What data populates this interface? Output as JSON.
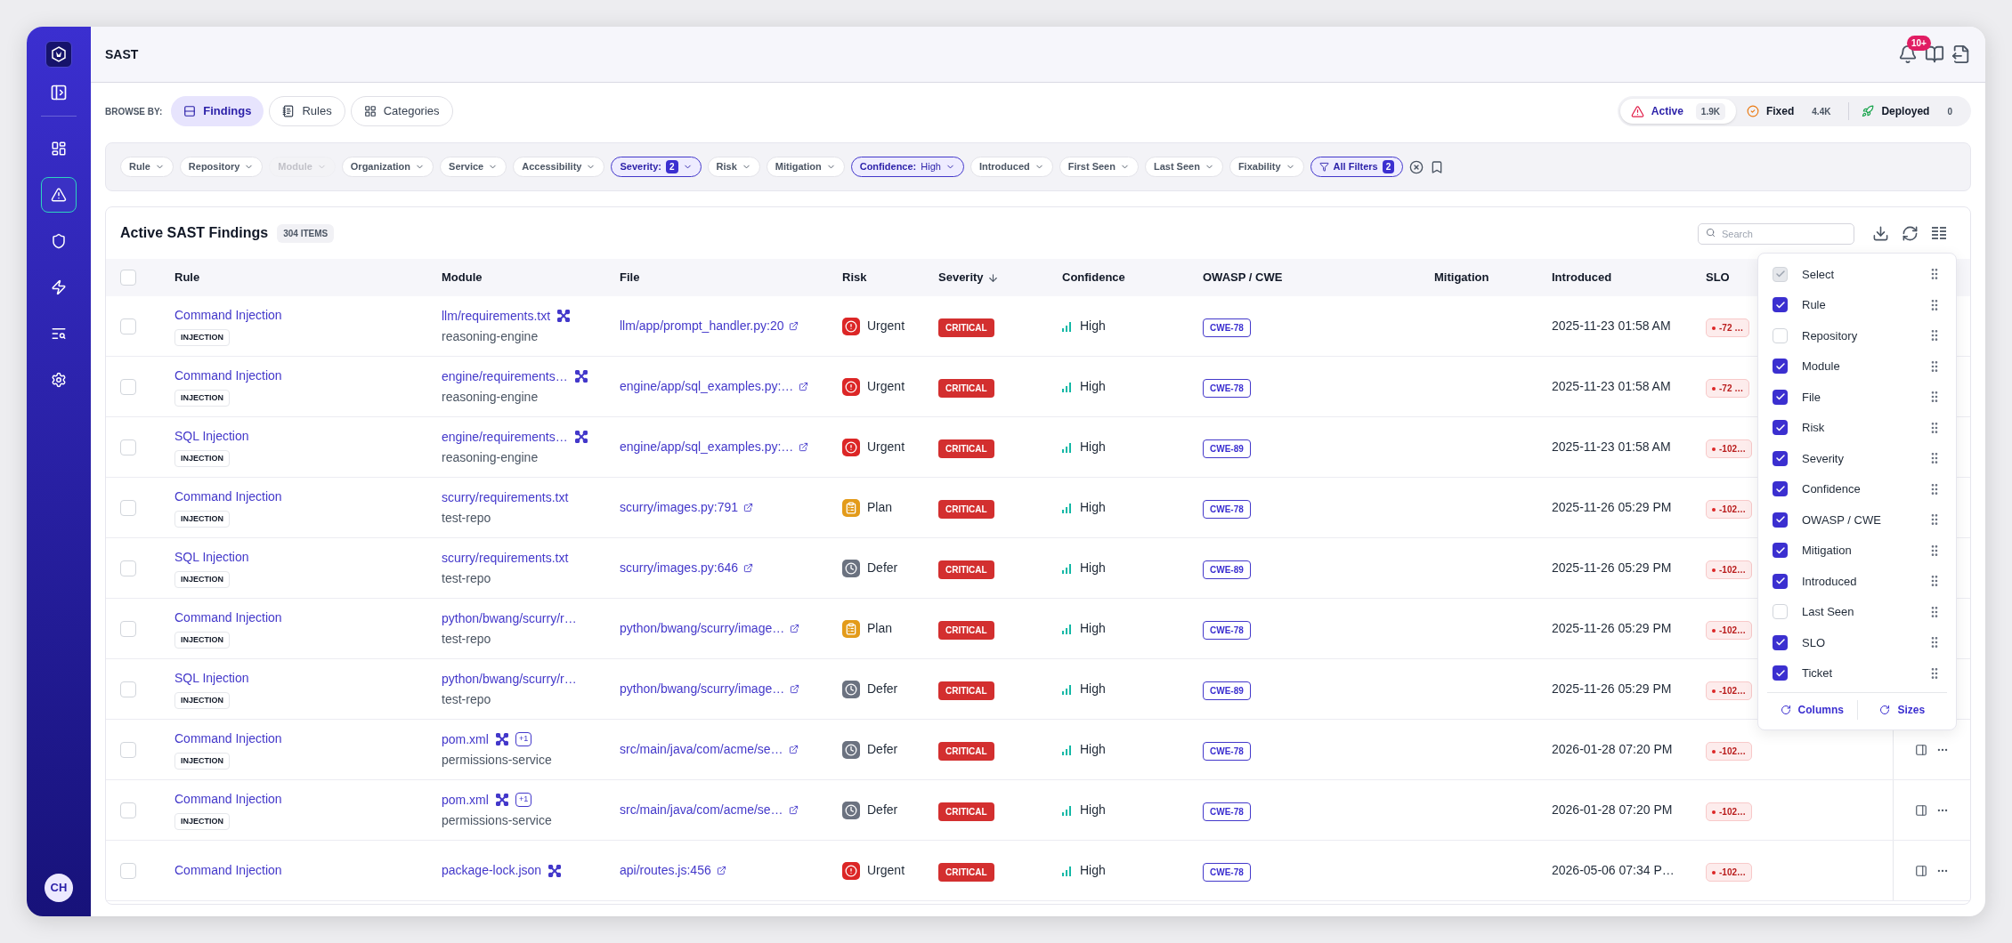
{
  "sidebar": {
    "items": [
      {
        "kind": "dashboard",
        "selected": false
      },
      {
        "kind": "alert",
        "selected": true
      },
      {
        "kind": "shield",
        "selected": false
      },
      {
        "kind": "zap",
        "selected": false
      },
      {
        "kind": "search-list",
        "selected": false
      },
      {
        "kind": "settings",
        "selected": false
      }
    ],
    "avatar": "CH"
  },
  "header": {
    "title": "SAST",
    "notifications": "10+"
  },
  "browse": {
    "label": "BROWSE BY:",
    "options": [
      {
        "label": "Findings",
        "kind": "findings",
        "selected": true
      },
      {
        "label": "Rules",
        "kind": "rules",
        "selected": false
      },
      {
        "label": "Categories",
        "kind": "categories",
        "selected": false
      }
    ]
  },
  "status": {
    "items": [
      {
        "label": "Active",
        "count": "1.9K",
        "kind": "active",
        "selected": true
      },
      {
        "label": "Fixed",
        "count": "4.4K",
        "kind": "fixed",
        "selected": false
      },
      {
        "label": "Deployed",
        "count": "0",
        "kind": "deployed",
        "selected": false
      }
    ]
  },
  "filters": [
    {
      "label": "Rule",
      "active": false,
      "disabled": false
    },
    {
      "label": "Repository",
      "active": false,
      "disabled": false
    },
    {
      "label": "Module",
      "active": false,
      "disabled": true
    },
    {
      "label": "Organization",
      "active": false,
      "disabled": false
    },
    {
      "label": "Service",
      "active": false,
      "disabled": false
    },
    {
      "label": "Accessibility",
      "active": false,
      "disabled": false
    },
    {
      "label": "Severity:",
      "count": "2",
      "active": true,
      "disabled": false
    },
    {
      "label": "Risk",
      "active": false,
      "disabled": false
    },
    {
      "label": "Mitigation",
      "active": false,
      "disabled": false
    },
    {
      "label": "Confidence:",
      "value": "High",
      "active": true,
      "disabled": false
    },
    {
      "label": "Introduced",
      "active": false,
      "disabled": false
    },
    {
      "label": "First Seen",
      "active": false,
      "disabled": false
    },
    {
      "label": "Last Seen",
      "active": false,
      "disabled": false
    },
    {
      "label": "Fixability",
      "active": false,
      "disabled": false
    }
  ],
  "all_filters": {
    "label": "All Filters",
    "count": "2"
  },
  "table": {
    "title": "Active SAST Findings",
    "count": "304 ITEMS",
    "search_placeholder": "Search",
    "select_all": false,
    "columns": [
      {
        "label": "Rule",
        "sorted": false
      },
      {
        "label": "Module",
        "sorted": false
      },
      {
        "label": "File",
        "sorted": false
      },
      {
        "label": "Risk",
        "sorted": false
      },
      {
        "label": "Severity",
        "sorted": true
      },
      {
        "label": "Confidence",
        "sorted": false
      },
      {
        "label": "OWASP / CWE",
        "sorted": false
      },
      {
        "label": "Mitigation",
        "sorted": false
      },
      {
        "label": "Introduced",
        "sorted": false
      },
      {
        "label": "SLO",
        "sorted": false
      }
    ],
    "rows": [
      {
        "selected": false,
        "rule": "Command Injection",
        "tag": "INJECTION",
        "module": "llm/requirements.txt",
        "linked": true,
        "repo": "reasoning-engine",
        "file": "llm/app/prompt_handler.py:20",
        "risk": {
          "label": "Urgent",
          "kind": "urgent"
        },
        "severity": "CRITICAL",
        "confidence": "High",
        "cwe": "CWE-78",
        "introduced": "2025-11-23 01:58 AM",
        "slo": "-72 …"
      },
      {
        "selected": false,
        "rule": "Command Injection",
        "tag": "INJECTION",
        "module": "engine/requirements…",
        "linked": true,
        "repo": "reasoning-engine",
        "file": "engine/app/sql_examples.py:…",
        "risk": {
          "label": "Urgent",
          "kind": "urgent"
        },
        "severity": "CRITICAL",
        "confidence": "High",
        "cwe": "CWE-78",
        "introduced": "2025-11-23 01:58 AM",
        "slo": "-72 …"
      },
      {
        "selected": false,
        "rule": "SQL Injection",
        "tag": "INJECTION",
        "module": "engine/requirements…",
        "linked": true,
        "repo": "reasoning-engine",
        "file": "engine/app/sql_examples.py:…",
        "risk": {
          "label": "Urgent",
          "kind": "urgent"
        },
        "severity": "CRITICAL",
        "confidence": "High",
        "cwe": "CWE-89",
        "introduced": "2025-11-23 01:58 AM",
        "slo": "-102…"
      },
      {
        "selected": false,
        "rule": "Command Injection",
        "tag": "INJECTION",
        "module": "scurry/requirements.txt",
        "linked": false,
        "repo": "test-repo",
        "file": "scurry/images.py:791",
        "risk": {
          "label": "Plan",
          "kind": "plan"
        },
        "severity": "CRITICAL",
        "confidence": "High",
        "cwe": "CWE-78",
        "introduced": "2025-11-26 05:29 PM",
        "slo": "-102…"
      },
      {
        "selected": false,
        "rule": "SQL Injection",
        "tag": "INJECTION",
        "module": "scurry/requirements.txt",
        "linked": false,
        "repo": "test-repo",
        "file": "scurry/images.py:646",
        "risk": {
          "label": "Defer",
          "kind": "defer"
        },
        "severity": "CRITICAL",
        "confidence": "High",
        "cwe": "CWE-89",
        "introduced": "2025-11-26 05:29 PM",
        "slo": "-102…"
      },
      {
        "selected": false,
        "rule": "Command Injection",
        "tag": "INJECTION",
        "module": "python/bwang/scurry/r…",
        "linked": false,
        "repo": "test-repo",
        "file": "python/bwang/scurry/image…",
        "risk": {
          "label": "Plan",
          "kind": "plan"
        },
        "severity": "CRITICAL",
        "confidence": "High",
        "cwe": "CWE-78",
        "introduced": "2025-11-26 05:29 PM",
        "slo": "-102…"
      },
      {
        "selected": false,
        "rule": "SQL Injection",
        "tag": "INJECTION",
        "module": "python/bwang/scurry/r…",
        "linked": false,
        "repo": "test-repo",
        "file": "python/bwang/scurry/image…",
        "risk": {
          "label": "Defer",
          "kind": "defer"
        },
        "severity": "CRITICAL",
        "confidence": "High",
        "cwe": "CWE-89",
        "introduced": "2025-11-26 05:29 PM",
        "slo": "-102…"
      },
      {
        "selected": false,
        "rule": "Command Injection",
        "tag": "INJECTION",
        "module": "pom.xml",
        "linked": true,
        "extra": "+1",
        "repo": "permissions-service",
        "file": "src/main/java/com/acme/se…",
        "risk": {
          "label": "Defer",
          "kind": "defer"
        },
        "severity": "CRITICAL",
        "confidence": "High",
        "cwe": "CWE-78",
        "introduced": "2026-01-28 07:20 PM",
        "slo": "-102…"
      },
      {
        "selected": false,
        "rule": "Command Injection",
        "tag": "INJECTION",
        "module": "pom.xml",
        "linked": true,
        "extra": "+1",
        "repo": "permissions-service",
        "file": "src/main/java/com/acme/se…",
        "risk": {
          "label": "Defer",
          "kind": "defer"
        },
        "severity": "CRITICAL",
        "confidence": "High",
        "cwe": "CWE-78",
        "introduced": "2026-01-28 07:20 PM",
        "slo": "-102…"
      },
      {
        "selected": false,
        "rule": "Command Injection",
        "module": "package-lock.json",
        "linked": true,
        "file": "api/routes.js:456",
        "risk": {
          "label": "Urgent",
          "kind": "urgent"
        },
        "severity": "CRITICAL",
        "confidence": "High",
        "cwe": "CWE-78",
        "introduced": "2026-05-06 07:34 P…",
        "slo": "-102…"
      }
    ]
  },
  "column_menu": {
    "items": [
      {
        "label": "Select",
        "checked": true,
        "disabled": true
      },
      {
        "label": "Rule",
        "checked": true,
        "disabled": false
      },
      {
        "label": "Repository",
        "checked": false,
        "disabled": false
      },
      {
        "label": "Module",
        "checked": true,
        "disabled": false
      },
      {
        "label": "File",
        "checked": true,
        "disabled": false
      },
      {
        "label": "Risk",
        "checked": true,
        "disabled": false
      },
      {
        "label": "Severity",
        "checked": true,
        "disabled": false
      },
      {
        "label": "Confidence",
        "checked": true,
        "disabled": false
      },
      {
        "label": "OWASP / CWE",
        "checked": true,
        "disabled": false
      },
      {
        "label": "Mitigation",
        "checked": true,
        "disabled": false
      },
      {
        "label": "Introduced",
        "checked": true,
        "disabled": false
      },
      {
        "label": "Last Seen",
        "checked": false,
        "disabled": false
      },
      {
        "label": "SLO",
        "checked": true,
        "disabled": false
      },
      {
        "label": "Ticket",
        "checked": true,
        "disabled": false
      }
    ],
    "reset_columns": "Columns",
    "reset_sizes": "Sizes"
  }
}
